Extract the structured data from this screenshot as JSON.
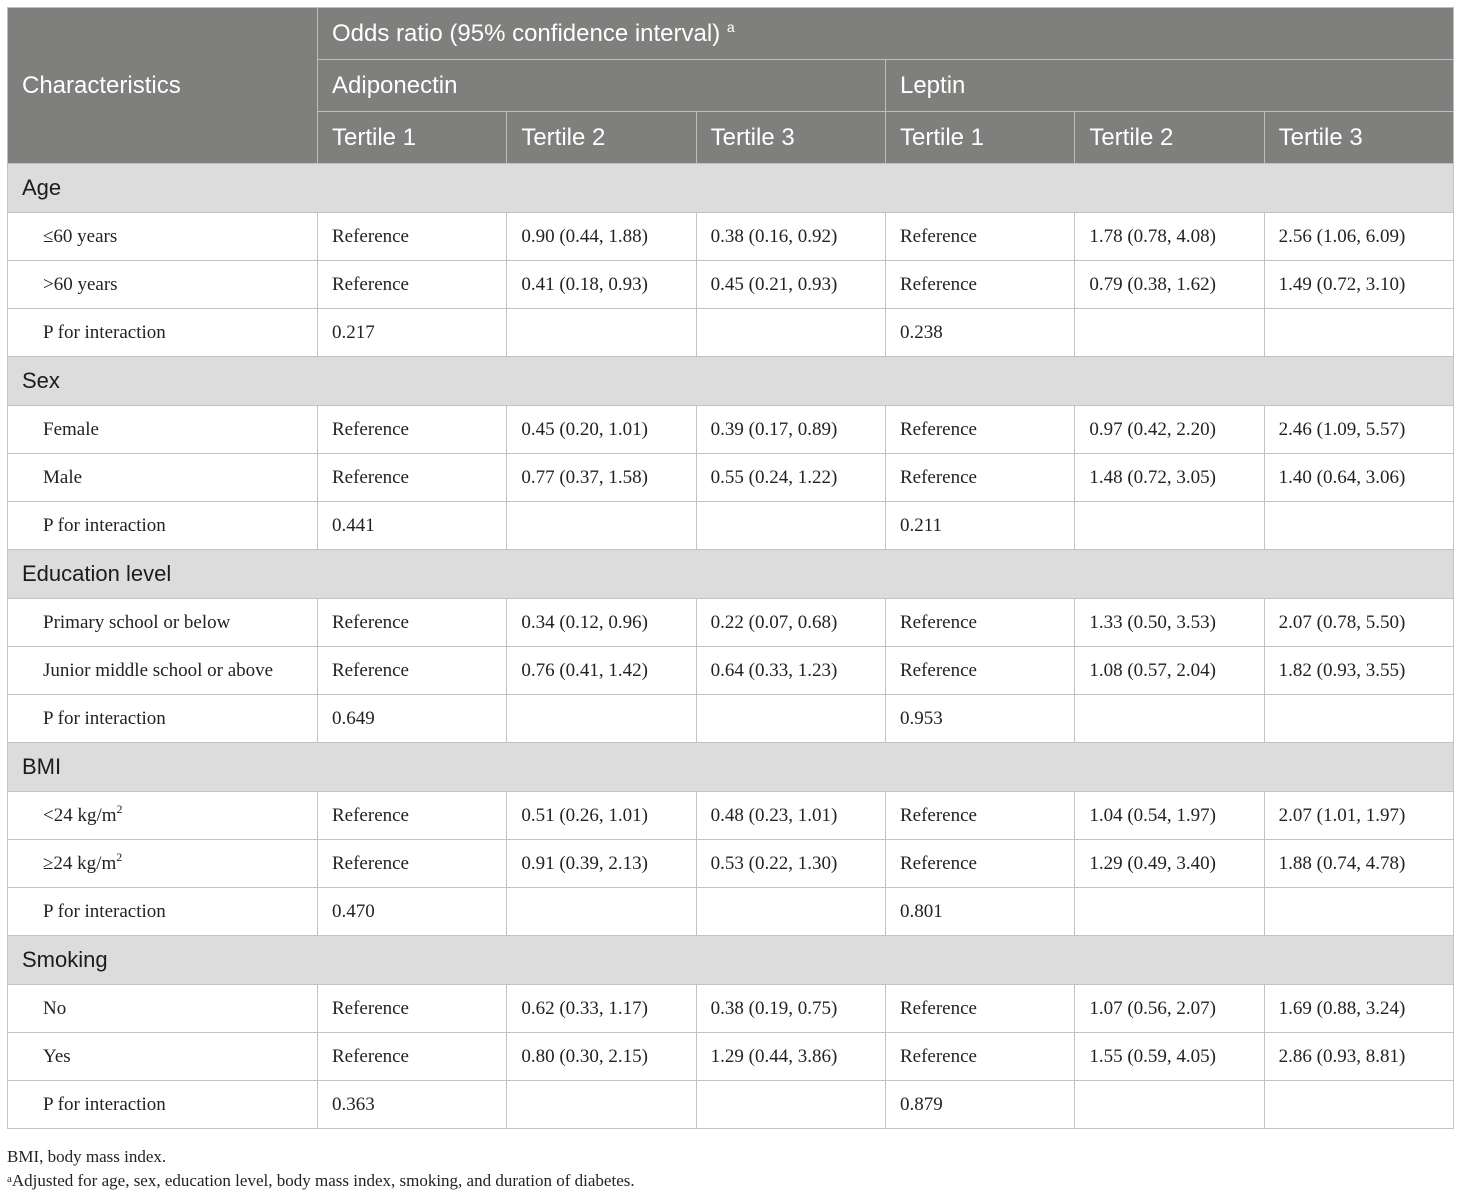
{
  "header": {
    "characteristics": "Characteristics",
    "odds_ratio": "Odds ratio (95% confidence interval)",
    "odds_ratio_sup": "a",
    "adiponectin": "Adiponectin",
    "leptin": "Leptin",
    "tertiles": [
      "Tertile 1",
      "Tertile 2",
      "Tertile 3",
      "Tertile 1",
      "Tertile 2",
      "Tertile 3"
    ]
  },
  "groups": [
    {
      "title": "Age",
      "rows": [
        {
          "label": "≤60 years",
          "label_sup": "",
          "cells": [
            "Reference",
            "0.90 (0.44, 1.88)",
            "0.38 (0.16, 0.92)",
            "Reference",
            "1.78 (0.78, 4.08)",
            "2.56 (1.06, 6.09)"
          ]
        },
        {
          "label": ">60 years",
          "label_sup": "",
          "cells": [
            "Reference",
            "0.41 (0.18, 0.93)",
            "0.45 (0.21, 0.93)",
            "Reference",
            "0.79 (0.38, 1.62)",
            "1.49 (0.72, 3.10)"
          ]
        },
        {
          "label": "P for interaction",
          "label_sup": "",
          "cells": [
            "0.217",
            "",
            "",
            "0.238",
            "",
            ""
          ]
        }
      ]
    },
    {
      "title": "Sex",
      "rows": [
        {
          "label": "Female",
          "label_sup": "",
          "cells": [
            "Reference",
            "0.45 (0.20, 1.01)",
            "0.39 (0.17, 0.89)",
            "Reference",
            "0.97 (0.42, 2.20)",
            "2.46 (1.09, 5.57)"
          ]
        },
        {
          "label": "Male",
          "label_sup": "",
          "cells": [
            "Reference",
            "0.77 (0.37, 1.58)",
            "0.55 (0.24, 1.22)",
            "Reference",
            "1.48 (0.72, 3.05)",
            "1.40 (0.64, 3.06)"
          ]
        },
        {
          "label": "P for interaction",
          "label_sup": "",
          "cells": [
            "0.441",
            "",
            "",
            "0.211",
            "",
            ""
          ]
        }
      ]
    },
    {
      "title": "Education level",
      "rows": [
        {
          "label": "Primary school or below",
          "label_sup": "",
          "cells": [
            "Reference",
            "0.34 (0.12, 0.96)",
            "0.22 (0.07, 0.68)",
            "Reference",
            "1.33 (0.50, 3.53)",
            "2.07 (0.78, 5.50)"
          ]
        },
        {
          "label": "Junior middle school or above",
          "label_sup": "",
          "cells": [
            "Reference",
            "0.76 (0.41, 1.42)",
            "0.64 (0.33, 1.23)",
            "Reference",
            "1.08 (0.57, 2.04)",
            "1.82 (0.93, 3.55)"
          ]
        },
        {
          "label": "P for interaction",
          "label_sup": "",
          "cells": [
            "0.649",
            "",
            "",
            "0.953",
            "",
            ""
          ]
        }
      ]
    },
    {
      "title": "BMI",
      "rows": [
        {
          "label": "<24 kg/m",
          "label_sup": "2",
          "cells": [
            "Reference",
            "0.51 (0.26, 1.01)",
            "0.48 (0.23, 1.01)",
            "Reference",
            "1.04 (0.54, 1.97)",
            "2.07 (1.01, 1.97)"
          ]
        },
        {
          "label": "≥24 kg/m",
          "label_sup": "2",
          "cells": [
            "Reference",
            "0.91 (0.39, 2.13)",
            "0.53 (0.22, 1.30)",
            "Reference",
            "1.29 (0.49, 3.40)",
            "1.88 (0.74, 4.78)"
          ]
        },
        {
          "label": "P for interaction",
          "label_sup": "",
          "cells": [
            "0.470",
            "",
            "",
            "0.801",
            "",
            ""
          ]
        }
      ]
    },
    {
      "title": "Smoking",
      "rows": [
        {
          "label": "No",
          "label_sup": "",
          "cells": [
            "Reference",
            "0.62 (0.33, 1.17)",
            "0.38 (0.19, 0.75)",
            "Reference",
            "1.07 (0.56, 2.07)",
            "1.69 (0.88, 3.24)"
          ]
        },
        {
          "label": "Yes",
          "label_sup": "",
          "cells": [
            "Reference",
            "0.80 (0.30, 2.15)",
            "1.29 (0.44, 3.86)",
            "Reference",
            "1.55 (0.59, 4.05)",
            "2.86 (0.93, 8.81)"
          ]
        },
        {
          "label": "P for interaction",
          "label_sup": "",
          "cells": [
            "0.363",
            "",
            "",
            "0.879",
            "",
            ""
          ]
        }
      ]
    }
  ],
  "footnotes": {
    "abbrev": "BMI, body mass index.",
    "adjusted_sup": "a",
    "adjusted": "Adjusted for age, sex, education level, body mass index, smoking, and duration of diabetes."
  }
}
